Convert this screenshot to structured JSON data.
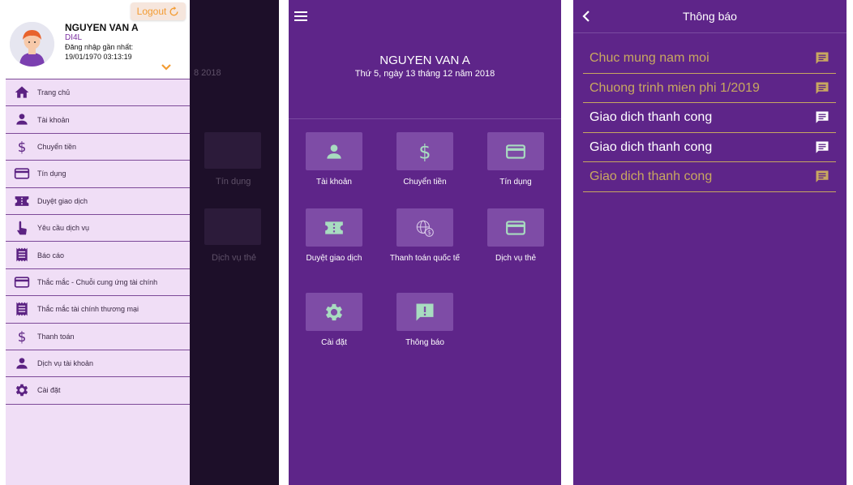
{
  "screen1": {
    "logout_label": "Logout",
    "user_name": "NGUYEN VAN A",
    "user_code": "DI4L",
    "last_login_label": "Đăng nhập gần nhất:",
    "last_login_value": "19/01/1970 03:13:19",
    "menu": [
      {
        "label": "Trang chủ",
        "icon": "home-icon"
      },
      {
        "label": "Tài khoản",
        "icon": "person-icon"
      },
      {
        "label": "Chuyển tiền",
        "icon": "dollar-icon"
      },
      {
        "label": "Tín dụng",
        "icon": "card-icon"
      },
      {
        "label": "Duyệt giao dịch",
        "icon": "ticket-icon"
      },
      {
        "label": "Yêu cầu dịch vụ",
        "icon": "touch-icon"
      },
      {
        "label": "Báo cáo",
        "icon": "receipt-icon"
      },
      {
        "label": "Thắc mắc - Chuỗi cung ứng tài chính",
        "icon": "card-icon"
      },
      {
        "label": "Thắc mắc tài chính thương mại",
        "icon": "receipt-icon"
      },
      {
        "label": "Thanh toán",
        "icon": "dollar-icon"
      },
      {
        "label": "Dịch vụ tài khoản",
        "icon": "person-icon"
      },
      {
        "label": "Cài đặt",
        "icon": "gear-icon"
      }
    ],
    "background_fragments": {
      "date_fragment": "8 2018",
      "tile_label_1": "Tín dụng",
      "tile_label_2": "Dịch vụ thẻ"
    }
  },
  "screen2": {
    "user_name": "NGUYEN VAN A",
    "date": "Thứ 5, ngày 13 tháng 12 năm 2018",
    "tiles": [
      {
        "label": "Tài khoản",
        "icon": "person-icon"
      },
      {
        "label": "Chuyển tiền",
        "icon": "dollar-icon"
      },
      {
        "label": "Tín dụng",
        "icon": "card-icon"
      },
      {
        "label": "Duyệt giao dịch",
        "icon": "ticket-icon"
      },
      {
        "label": "Thanh toán quốc tế",
        "icon": "globe-dollar-icon"
      },
      {
        "label": "Dịch vụ thẻ",
        "icon": "card-icon"
      },
      {
        "label": "Cài đặt",
        "icon": "gear-icon"
      },
      {
        "label": "Thông báo",
        "icon": "alert-message-icon"
      }
    ]
  },
  "screen3": {
    "title": "Thông báo",
    "notifications": [
      {
        "text": "Chuc mung nam moi",
        "read": true
      },
      {
        "text": "Chuong trinh mien phi  1/2019",
        "read": true
      },
      {
        "text": "Giao dich thanh cong",
        "read": false
      },
      {
        "text": "Giao dich thanh cong",
        "read": false
      },
      {
        "text": "Giao dich thanh cong",
        "read": true
      }
    ]
  },
  "colors": {
    "brand_purple": "#5e2589",
    "tile_purple": "#7e4ca6",
    "icon_green": "#a8dcc0",
    "drawer_pink": "#f0def6",
    "drawer_icon": "#5b2282",
    "logout_orange": "#f39c33",
    "read_gold": "#c8a860"
  }
}
